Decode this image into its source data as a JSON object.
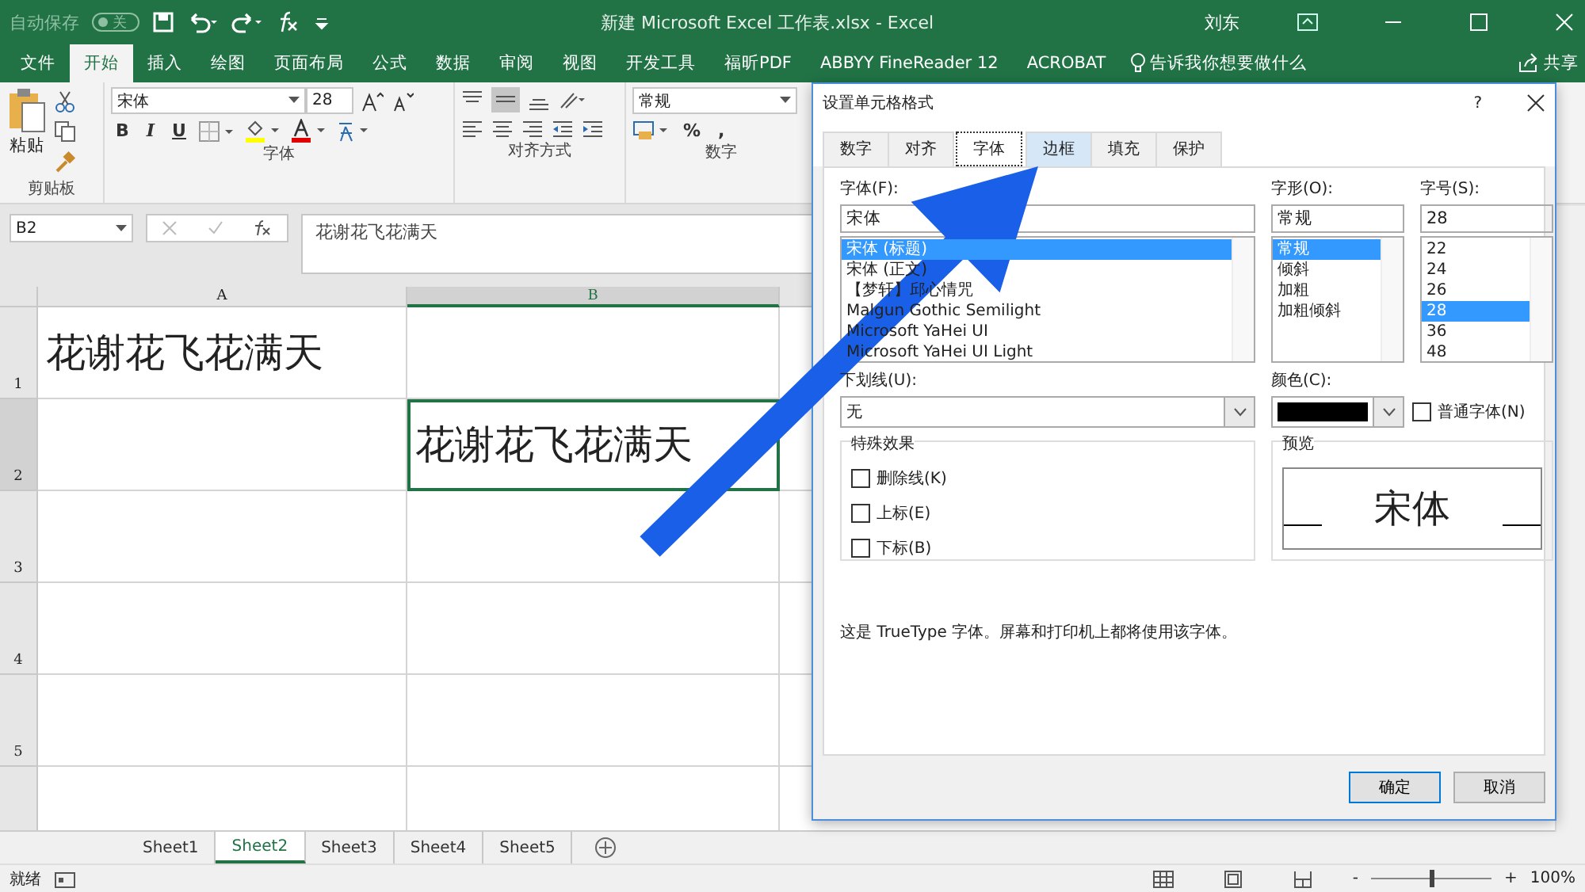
{
  "title_bar": {
    "autosave_label": "自动保存",
    "autosave_toggle": {
      "label": "关",
      "on": false
    },
    "title": "新建 Microsoft Excel 工作表.xlsx  -  Excel",
    "user": "刘东"
  },
  "ribbon_tabs": [
    {
      "label": "文件",
      "selected": false
    },
    {
      "label": "开始",
      "selected": true
    },
    {
      "label": "插入",
      "selected": false
    },
    {
      "label": "绘图",
      "selected": false
    },
    {
      "label": "页面布局",
      "selected": false
    },
    {
      "label": "公式",
      "selected": false
    },
    {
      "label": "数据",
      "selected": false
    },
    {
      "label": "审阅",
      "selected": false
    },
    {
      "label": "视图",
      "selected": false
    },
    {
      "label": "开发工具",
      "selected": false
    },
    {
      "label": "福昕PDF",
      "selected": false
    },
    {
      "label": "ABBYY FineReader 12",
      "selected": false
    },
    {
      "label": "ACROBAT",
      "selected": false
    }
  ],
  "tell_me": "告诉我你想要做什么",
  "share": "共享",
  "ribbon": {
    "paste": "粘贴",
    "font_name": "宋体",
    "font_size": "28",
    "bold": "B",
    "italic": "I",
    "underline": "U",
    "number_format": "常规",
    "percent": "%",
    "comma": ",",
    "groups": [
      "剪贴板",
      "字体",
      "对齐方式",
      "数字"
    ]
  },
  "formula_bar": {
    "name_box": "B2",
    "formula": "花谢花飞花满天"
  },
  "sheet": {
    "columns": [
      {
        "label": "A",
        "selected": false
      },
      {
        "label": "B",
        "selected": true
      }
    ],
    "rows": [
      {
        "label": "1",
        "selected": false,
        "cells": [
          {
            "text": "花谢花飞花满天",
            "selected": false
          },
          {
            "selected": false
          }
        ]
      },
      {
        "label": "2",
        "selected": true,
        "cells": [
          {
            "selected": false
          },
          {
            "text": "花谢花飞花满天",
            "selected": true
          }
        ]
      },
      {
        "label": "3",
        "selected": false,
        "cells": [
          {
            "selected": false
          },
          {
            "selected": false
          }
        ]
      },
      {
        "label": "4",
        "selected": false,
        "cells": [
          {
            "selected": false
          },
          {
            "selected": false
          }
        ]
      },
      {
        "label": "5",
        "selected": false,
        "cells": [
          {
            "selected": false
          },
          {
            "selected": false
          }
        ]
      }
    ]
  },
  "sheet_tabs": [
    {
      "label": "Sheet1",
      "selected": false
    },
    {
      "label": "Sheet2",
      "selected": true
    },
    {
      "label": "Sheet3",
      "selected": false
    },
    {
      "label": "Sheet4",
      "selected": false
    },
    {
      "label": "Sheet5",
      "selected": false
    }
  ],
  "status_bar": {
    "status": "就绪",
    "zoom": "100%",
    "zoom_out": "-",
    "zoom_in": "+",
    "zoom_slider": {
      "level": 0.5
    }
  },
  "dialog": {
    "title": "设置单元格格式",
    "help": "?",
    "tabs": [
      {
        "label": "数字",
        "selected": false,
        "highlighted": false
      },
      {
        "label": "对齐",
        "selected": false,
        "highlighted": false
      },
      {
        "label": "字体",
        "selected": true,
        "highlighted": false
      },
      {
        "label": "边框",
        "selected": false,
        "highlighted": true
      },
      {
        "label": "填充",
        "selected": false,
        "highlighted": false
      },
      {
        "label": "保护",
        "selected": false,
        "highlighted": false
      }
    ],
    "font": {
      "label": "字体(F):",
      "value": "宋体",
      "items": [
        {
          "label": "宋体 (标题)",
          "selected": true
        },
        {
          "label": "宋体 (正文)",
          "selected": false
        },
        {
          "label": "【梦轩】邱心情咒",
          "selected": false
        },
        {
          "label": "Malgun Gothic Semilight",
          "selected": false
        },
        {
          "label": "Microsoft YaHei UI",
          "selected": false
        },
        {
          "label": "Microsoft YaHei UI Light",
          "selected": false
        }
      ]
    },
    "style": {
      "label": "字形(O):",
      "value": "常规",
      "items": [
        {
          "label": "常规",
          "selected": true
        },
        {
          "label": "倾斜",
          "selected": false
        },
        {
          "label": "加粗",
          "selected": false
        },
        {
          "label": "加粗倾斜",
          "selected": false
        }
      ]
    },
    "size": {
      "label": "字号(S):",
      "value": "28",
      "items": [
        {
          "label": "22",
          "selected": false
        },
        {
          "label": "24",
          "selected": false
        },
        {
          "label": "26",
          "selected": false
        },
        {
          "label": "28",
          "selected": true
        },
        {
          "label": "36",
          "selected": false
        },
        {
          "label": "48",
          "selected": false
        }
      ]
    },
    "underline": {
      "label": "下划线(U):",
      "value": "无"
    },
    "color": {
      "label": "颜色(C):",
      "color": "#000000"
    },
    "normal_font": {
      "label": "普通字体(N)",
      "checked": false
    },
    "effects": {
      "label": "特殊效果",
      "items": [
        {
          "label": "删除线(K)",
          "checked": false
        },
        {
          "label": "上标(E)",
          "checked": false
        },
        {
          "label": "下标(B)",
          "checked": false
        }
      ]
    },
    "preview": {
      "label": "预览",
      "text": "宋体"
    },
    "info": "这是 TrueType 字体。屏幕和打印机上都将使用该字体。",
    "buttons": [
      {
        "label": "确定",
        "default": true
      },
      {
        "label": "取消",
        "default": false
      }
    ]
  }
}
